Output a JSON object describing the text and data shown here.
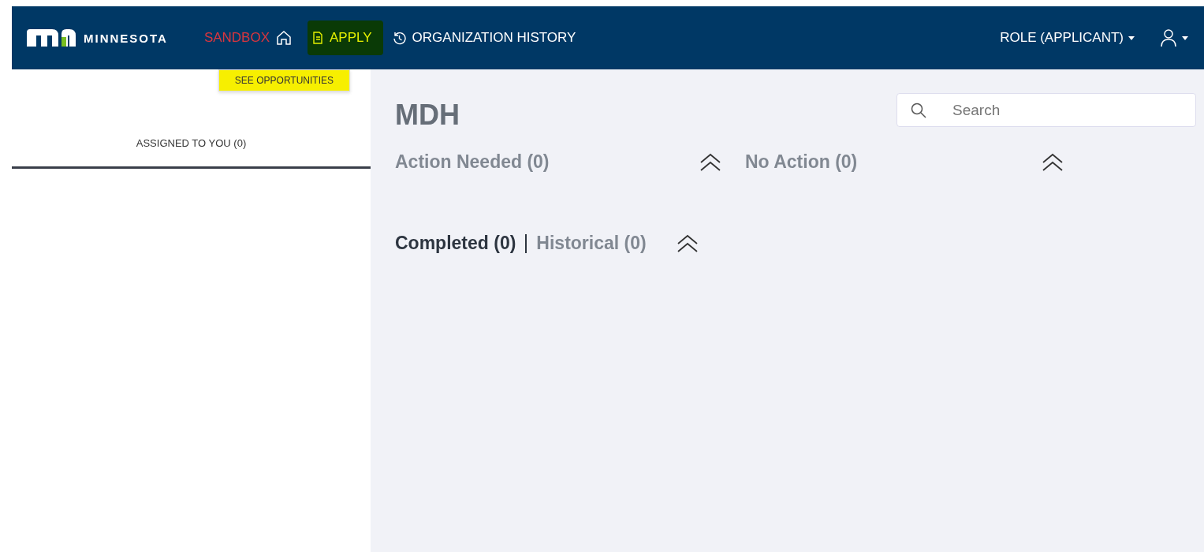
{
  "header": {
    "logo_text": "MINNESOTA",
    "environment": "SANDBOX",
    "nav": [
      {
        "label": "APPLY",
        "kind": "apply",
        "highlighted": true
      },
      {
        "label": "ORGANIZATION HISTORY",
        "kind": "history",
        "highlighted": false
      }
    ],
    "role": "ROLE (APPLICANT)"
  },
  "submenu": {
    "label": "SEE OPPORTUNITIES",
    "highlighted": true
  },
  "sidebar": {
    "tabs": [
      {
        "label": "ASSIGNED TO YOU (0)",
        "selected": true
      }
    ]
  },
  "main": {
    "title": "MDH",
    "search": {
      "placeholder": "Search"
    },
    "sections": [
      {
        "label": "Action Needed (0)",
        "expanded": true
      },
      {
        "label": "No Action (0)",
        "expanded": true
      }
    ],
    "bottom_tabs": [
      {
        "label": "Completed (0)",
        "selected": true
      },
      {
        "label": "Historical (0)",
        "selected": false
      }
    ],
    "bottom_expanded": true
  }
}
